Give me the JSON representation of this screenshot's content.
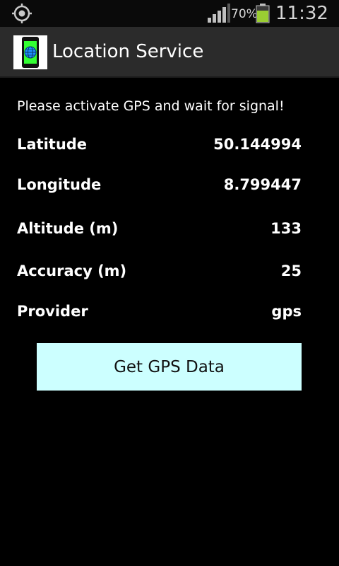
{
  "status_bar": {
    "battery_percent": "70%",
    "time": "11:32",
    "icons": [
      "gps-icon",
      "signal-icon",
      "battery-icon"
    ]
  },
  "app_bar": {
    "title": "Location Service",
    "icon": "phone-globe-icon"
  },
  "main": {
    "instruction": "Please activate GPS and wait for signal!",
    "fields": [
      {
        "label": "Latitude",
        "value": "50.144994"
      },
      {
        "label": "Longitude",
        "value": "8.799447"
      },
      {
        "label": "Altitude (m)",
        "value": "133"
      },
      {
        "label": "Accuracy (m)",
        "value": "25"
      },
      {
        "label": "Provider",
        "value": "gps"
      }
    ],
    "button_label": "Get GPS Data"
  },
  "colors": {
    "background": "#000000",
    "title_bar": "#2b2b2b",
    "button": "#ccffff",
    "battery_green": "#9acd32"
  }
}
